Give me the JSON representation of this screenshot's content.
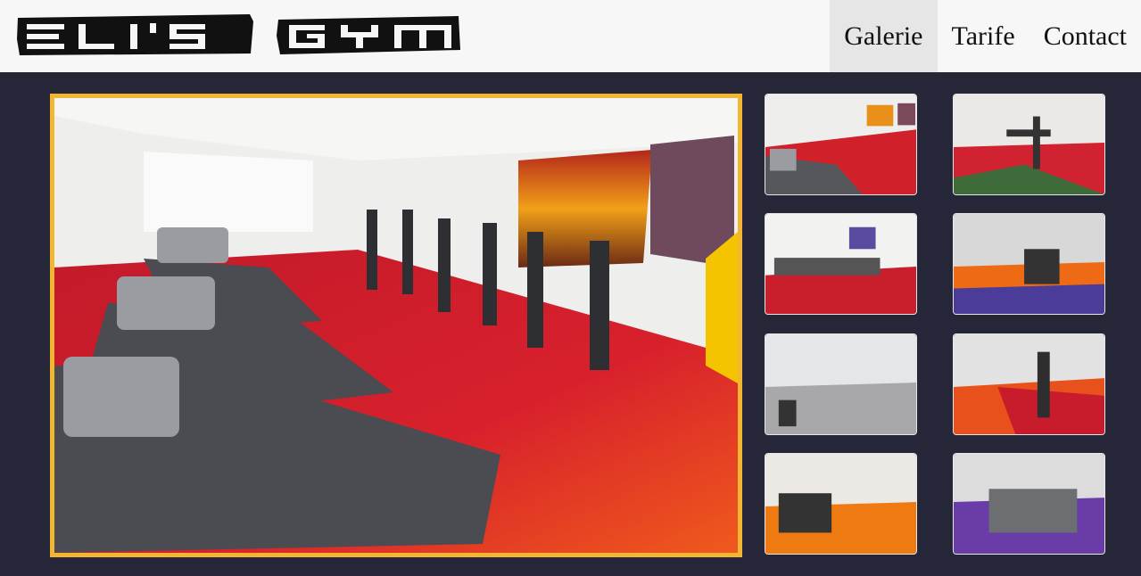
{
  "brand": {
    "logo_text": "ELI'S GYM"
  },
  "nav": {
    "items": [
      {
        "label": "Galerie",
        "active": true
      },
      {
        "label": "Tarife",
        "active": false
      },
      {
        "label": "Contact",
        "active": false
      }
    ]
  },
  "gallery": {
    "accent_color": "#f2b632",
    "background_color": "#252738",
    "main_image": "cardio-room-red-floor",
    "thumbnails": [
      "cardio-room-red-floor",
      "weights-area-red-green-floor",
      "treadmill-row-red-floor",
      "machines-orange-purple-floor",
      "empty-studio-grey-floor",
      "weight-racks-orange-red-floor",
      "dumbbell-rack-orange-floor",
      "machines-purple-floor"
    ]
  }
}
